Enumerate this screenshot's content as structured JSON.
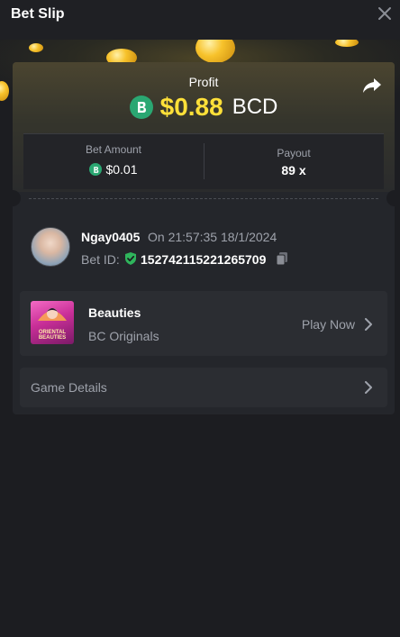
{
  "header": {
    "title": "Bet Slip"
  },
  "profit": {
    "label": "Profit",
    "amount": "$0.88",
    "currency": "BCD"
  },
  "stats": {
    "bet_amount_label": "Bet Amount",
    "bet_amount_value": "$0.01",
    "payout_label": "Payout",
    "payout_value": "89 x"
  },
  "user": {
    "name": "Ngay0405",
    "time": "On 21:57:35 18/1/2024",
    "bet_id_label": "Bet ID:",
    "bet_id": "152742115221265709"
  },
  "game": {
    "title": "Beauties",
    "subtitle": "BC Originals",
    "thumb_text": "ORIENTAL BEAUTIES",
    "action": "Play Now"
  },
  "details": {
    "label": "Game Details"
  },
  "colors": {
    "accent_gold": "#ffe039",
    "bc_green": "#2aa772",
    "background": "#1c1d21"
  }
}
